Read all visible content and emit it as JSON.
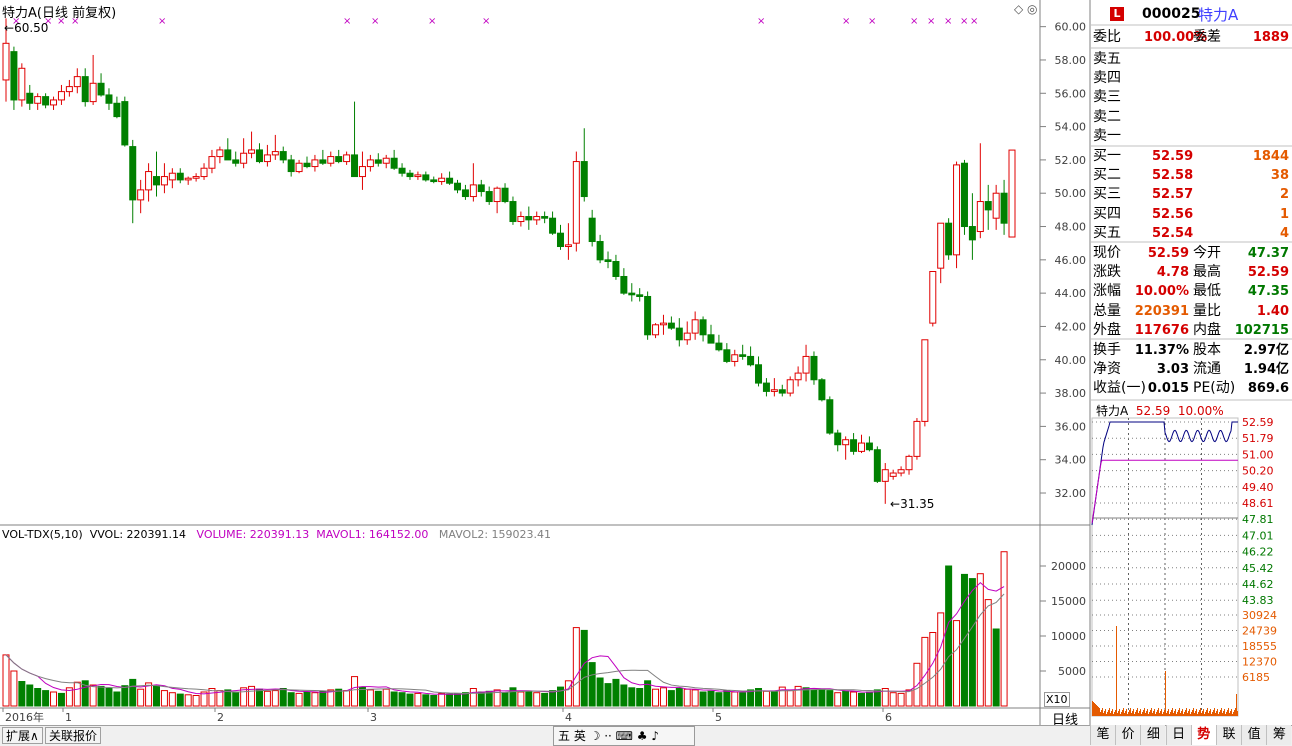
{
  "header": {
    "title": "特力A",
    "title_suffix": "(日线 前复权)",
    "corner_icons": "◇ ◎"
  },
  "main_chart": {
    "high_label": "60.50",
    "low_label": "31.35",
    "y_ticks": [
      "60.00",
      "58.00",
      "56.00",
      "54.00",
      "52.00",
      "50.00",
      "48.00",
      "46.00",
      "44.00",
      "42.00",
      "40.00",
      "38.00",
      "36.00",
      "34.00",
      "32.00"
    ]
  },
  "volume_panel": {
    "title": "VOL-TDX(5,10)",
    "vvol": "VVOL: 220391.14",
    "volume": "VOLUME: 220391.13",
    "mavol1": "MAVOL1: 164152.00",
    "mavol2": "MAVOL2: 159023.41",
    "y_ticks": [
      "20000",
      "15000",
      "10000",
      "5000"
    ],
    "unit": "X10"
  },
  "x_axis": {
    "labels": [
      "2016年",
      "1",
      "2",
      "3",
      "4",
      "5",
      "6"
    ],
    "period": "日线"
  },
  "right_panel": {
    "logo": "L",
    "code": "000025",
    "name": "特力A",
    "weibi_label": "委比",
    "weibi": "100.00%",
    "weicha_label": "委差",
    "weicha": "1889",
    "sells": [
      {
        "label": "卖五",
        "price": "",
        "vol": ""
      },
      {
        "label": "卖四",
        "price": "",
        "vol": ""
      },
      {
        "label": "卖三",
        "price": "",
        "vol": ""
      },
      {
        "label": "卖二",
        "price": "",
        "vol": ""
      },
      {
        "label": "卖一",
        "price": "",
        "vol": ""
      }
    ],
    "buys": [
      {
        "label": "买一",
        "price": "52.59",
        "vol": "1844"
      },
      {
        "label": "买二",
        "price": "52.58",
        "vol": "38"
      },
      {
        "label": "买三",
        "price": "52.57",
        "vol": "2"
      },
      {
        "label": "买四",
        "price": "52.56",
        "vol": "1"
      },
      {
        "label": "买五",
        "price": "52.54",
        "vol": "4"
      }
    ],
    "quote": [
      {
        "l1": "现价",
        "v1": "52.59",
        "c1": "red",
        "l2": "今开",
        "v2": "47.37",
        "c2": "green"
      },
      {
        "l1": "涨跌",
        "v1": "4.78",
        "c1": "red",
        "l2": "最高",
        "v2": "52.59",
        "c2": "red"
      },
      {
        "l1": "涨幅",
        "v1": "10.00%",
        "c1": "red",
        "l2": "最低",
        "v2": "47.35",
        "c2": "green"
      },
      {
        "l1": "总量",
        "v1": "220391",
        "c1": "orange",
        "l2": "量比",
        "v2": "1.40",
        "c2": "red"
      },
      {
        "l1": "外盘",
        "v1": "117676",
        "c1": "red",
        "l2": "内盘",
        "v2": "102715",
        "c2": "green"
      }
    ],
    "stats": [
      {
        "l1": "换手",
        "v1": "11.37%",
        "l2": "股本",
        "v2": "2.97亿"
      },
      {
        "l1": "净资",
        "v1": "3.03",
        "l2": "流通",
        "v2": "1.94亿"
      },
      {
        "l1": "收益(一)",
        "v1": "0.015",
        "l2": "PE(动)",
        "v2": "869.6"
      }
    ],
    "mini": {
      "name": "特力A",
      "price": "52.59",
      "pct": "10.00%",
      "price_ticks": [
        "52.59",
        "51.79",
        "51.00",
        "50.20",
        "49.40",
        "48.61",
        "47.81",
        "47.01",
        "46.22",
        "45.42",
        "44.62",
        "43.83"
      ],
      "vol_ticks": [
        "30924",
        "24739",
        "18555",
        "12370",
        "6185"
      ]
    },
    "tabs": [
      "笔",
      "价",
      "细",
      "日",
      "势",
      "联",
      "值",
      "筹"
    ],
    "active_tab": "势"
  },
  "statusbar": {
    "btn1": "扩展∧",
    "btn2": "关联报价",
    "ime": "五 英 ☽ ·· ⌨ ♣ ♪"
  },
  "colors": {
    "up": "#e00000",
    "down": "#008000",
    "ma1": "#c000c0",
    "ma2": "#808080",
    "wline": "#000080"
  },
  "chart_data": {
    "type": "candlestick",
    "title": "特力A (日线 前复权)",
    "ohlc_approx": [
      [
        56.8,
        60.5,
        55.5,
        59.0
      ],
      [
        58.5,
        58.8,
        55.0,
        55.6
      ],
      [
        55.6,
        57.8,
        55.2,
        57.5
      ],
      [
        56.0,
        56.5,
        55.0,
        55.4
      ],
      [
        55.4,
        56.0,
        55.0,
        55.8
      ],
      [
        55.8,
        56.0,
        55.1,
        55.3
      ],
      [
        55.3,
        55.8,
        55.0,
        55.6
      ],
      [
        55.6,
        56.5,
        55.3,
        56.1
      ],
      [
        56.1,
        56.8,
        55.8,
        56.4
      ],
      [
        56.4,
        57.5,
        56.0,
        57.0
      ],
      [
        57.0,
        57.5,
        55.2,
        55.5
      ],
      [
        55.5,
        58.3,
        55.3,
        56.6
      ],
      [
        56.6,
        57.2,
        55.8,
        55.9
      ],
      [
        55.9,
        56.3,
        55.0,
        55.4
      ],
      [
        55.4,
        55.8,
        54.5,
        54.6
      ],
      [
        55.5,
        55.8,
        52.8,
        52.9
      ],
      [
        52.8,
        53.2,
        48.2,
        49.6
      ],
      [
        49.6,
        50.8,
        48.8,
        50.2
      ],
      [
        50.2,
        51.8,
        49.5,
        51.3
      ],
      [
        51.0,
        52.5,
        49.8,
        50.5
      ],
      [
        50.5,
        51.8,
        50.0,
        51.0
      ],
      [
        50.8,
        51.5,
        50.3,
        51.2
      ],
      [
        51.2,
        51.5,
        50.6,
        50.8
      ],
      [
        50.8,
        51.0,
        50.5,
        50.9
      ],
      [
        50.9,
        51.2,
        50.7,
        51.0
      ],
      [
        51.0,
        51.8,
        50.8,
        51.5
      ],
      [
        51.5,
        52.6,
        51.2,
        52.2
      ],
      [
        52.2,
        52.8,
        51.8,
        52.6
      ],
      [
        52.6,
        53.3,
        52.0,
        52.0
      ],
      [
        52.0,
        52.5,
        51.6,
        51.8
      ],
      [
        51.8,
        53.3,
        51.5,
        52.4
      ],
      [
        52.4,
        53.7,
        52.1,
        52.6
      ],
      [
        52.6,
        53.0,
        51.8,
        51.9
      ],
      [
        51.9,
        52.9,
        51.6,
        52.3
      ],
      [
        52.3,
        53.5,
        52.0,
        52.5
      ],
      [
        52.5,
        52.8,
        51.8,
        52.0
      ],
      [
        52.0,
        52.3,
        51.0,
        51.3
      ],
      [
        51.3,
        52.0,
        51.2,
        51.8
      ],
      [
        51.8,
        52.2,
        51.5,
        51.6
      ],
      [
        51.6,
        52.3,
        51.3,
        52.0
      ],
      [
        52.0,
        52.6,
        51.7,
        51.8
      ],
      [
        51.8,
        52.5,
        51.6,
        52.2
      ],
      [
        52.2,
        52.6,
        51.8,
        51.9
      ],
      [
        51.9,
        52.5,
        51.7,
        52.3
      ],
      [
        52.3,
        55.5,
        52.0,
        51.0
      ],
      [
        51.0,
        52.5,
        50.2,
        51.6
      ],
      [
        51.6,
        52.3,
        51.3,
        52.0
      ],
      [
        52.0,
        52.4,
        51.6,
        51.8
      ],
      [
        51.8,
        52.3,
        51.5,
        52.1
      ],
      [
        52.1,
        52.6,
        51.4,
        51.5
      ],
      [
        51.5,
        51.8,
        51.0,
        51.2
      ],
      [
        51.2,
        51.4,
        50.8,
        51.0
      ],
      [
        51.0,
        51.3,
        50.8,
        51.1
      ],
      [
        51.1,
        51.3,
        50.7,
        50.8
      ],
      [
        50.8,
        51.0,
        50.6,
        50.7
      ],
      [
        50.7,
        51.2,
        50.5,
        50.9
      ],
      [
        50.9,
        51.3,
        50.5,
        50.6
      ],
      [
        50.6,
        50.8,
        50.0,
        50.2
      ],
      [
        50.2,
        50.5,
        49.6,
        49.8
      ],
      [
        49.8,
        51.8,
        49.5,
        50.5
      ],
      [
        50.5,
        50.8,
        49.8,
        50.1
      ],
      [
        50.1,
        50.4,
        49.3,
        49.5
      ],
      [
        49.5,
        50.4,
        48.8,
        50.3
      ],
      [
        50.3,
        50.6,
        49.4,
        49.5
      ],
      [
        49.5,
        49.8,
        48.1,
        48.3
      ],
      [
        48.3,
        48.9,
        48.0,
        48.6
      ],
      [
        48.6,
        49.2,
        47.8,
        48.4
      ],
      [
        48.4,
        48.9,
        48.1,
        48.6
      ],
      [
        48.6,
        48.9,
        48.2,
        48.5
      ],
      [
        48.5,
        48.9,
        47.5,
        47.6
      ],
      [
        47.6,
        48.1,
        46.6,
        46.8
      ],
      [
        46.8,
        48.2,
        46.0,
        46.9
      ],
      [
        47.0,
        52.5,
        46.5,
        51.9
      ],
      [
        51.9,
        53.9,
        49.5,
        49.8
      ],
      [
        48.5,
        49.0,
        46.8,
        47.1
      ],
      [
        47.1,
        47.5,
        45.8,
        46.0
      ],
      [
        46.0,
        46.5,
        45.5,
        45.9
      ],
      [
        45.9,
        46.3,
        44.8,
        45.0
      ],
      [
        45.0,
        45.5,
        43.9,
        44.0
      ],
      [
        44.0,
        44.6,
        43.5,
        43.9
      ],
      [
        43.9,
        44.3,
        43.5,
        43.8
      ],
      [
        43.8,
        44.1,
        41.2,
        41.5
      ],
      [
        41.5,
        42.2,
        41.3,
        42.1
      ],
      [
        42.1,
        42.7,
        41.5,
        42.2
      ],
      [
        42.2,
        42.6,
        41.8,
        41.9
      ],
      [
        41.9,
        42.5,
        40.8,
        41.2
      ],
      [
        41.2,
        42.3,
        40.9,
        41.6
      ],
      [
        41.6,
        42.9,
        41.2,
        42.4
      ],
      [
        42.4,
        42.6,
        41.1,
        41.5
      ],
      [
        41.5,
        42.1,
        41.0,
        41.0
      ],
      [
        41.0,
        41.5,
        40.5,
        40.6
      ],
      [
        40.6,
        41.0,
        39.8,
        39.9
      ],
      [
        39.9,
        40.6,
        39.6,
        40.3
      ],
      [
        40.3,
        40.9,
        40.0,
        40.2
      ],
      [
        40.2,
        40.8,
        39.6,
        39.7
      ],
      [
        39.7,
        40.2,
        38.4,
        38.6
      ],
      [
        38.6,
        38.9,
        37.8,
        38.1
      ],
      [
        38.1,
        38.9,
        37.8,
        38.2
      ],
      [
        38.2,
        38.5,
        37.8,
        38.0
      ],
      [
        38.0,
        39.0,
        37.8,
        38.8
      ],
      [
        38.8,
        39.6,
        38.4,
        39.2
      ],
      [
        39.2,
        40.9,
        38.7,
        40.2
      ],
      [
        40.2,
        40.5,
        38.5,
        38.8
      ],
      [
        38.8,
        38.9,
        37.5,
        37.6
      ],
      [
        37.6,
        37.8,
        35.5,
        35.6
      ],
      [
        35.6,
        35.8,
        34.5,
        34.9
      ],
      [
        34.9,
        35.4,
        34.0,
        35.2
      ],
      [
        35.2,
        35.6,
        34.3,
        34.5
      ],
      [
        34.5,
        35.5,
        34.4,
        35.0
      ],
      [
        35.0,
        35.4,
        34.5,
        34.6
      ],
      [
        34.6,
        34.8,
        32.6,
        32.7
      ],
      [
        32.7,
        33.8,
        31.35,
        33.4
      ],
      [
        33.0,
        33.4,
        32.8,
        33.2
      ],
      [
        33.2,
        33.6,
        33.0,
        33.4
      ],
      [
        33.4,
        34.3,
        33.1,
        34.2
      ],
      [
        34.2,
        36.5,
        34.0,
        36.3
      ],
      [
        36.3,
        41.2,
        36.0,
        41.2
      ],
      [
        42.2,
        44.8,
        42.0,
        45.3
      ],
      [
        45.5,
        47.0,
        44.6,
        48.2
      ],
      [
        48.2,
        48.5,
        46.0,
        46.3
      ],
      [
        46.3,
        51.9,
        45.5,
        51.7
      ],
      [
        51.8,
        52.0,
        47.5,
        48.0
      ],
      [
        48.0,
        50.0,
        46.0,
        47.2
      ],
      [
        47.7,
        53.0,
        47.3,
        49.5
      ],
      [
        49.5,
        50.5,
        47.8,
        49.0
      ],
      [
        48.5,
        50.5,
        47.8,
        50.0
      ],
      [
        50.0,
        50.8,
        47.5,
        48.2
      ],
      [
        47.37,
        52.59,
        47.35,
        52.59
      ]
    ],
    "ylim": [
      30.5,
      61.0
    ],
    "volume": [
      [
        7300,
        "up"
      ],
      [
        5000,
        "up"
      ],
      [
        3500,
        "down"
      ],
      [
        3000,
        "down"
      ],
      [
        2500,
        "down"
      ],
      [
        2200,
        "down"
      ],
      [
        2000,
        "up"
      ],
      [
        1800,
        "down"
      ],
      [
        2600,
        "up"
      ],
      [
        3400,
        "up"
      ],
      [
        3600,
        "down"
      ],
      [
        3000,
        "up"
      ],
      [
        2800,
        "down"
      ],
      [
        2500,
        "down"
      ],
      [
        2000,
        "down"
      ],
      [
        2900,
        "down"
      ],
      [
        3800,
        "down"
      ],
      [
        2400,
        "up"
      ],
      [
        3300,
        "up"
      ],
      [
        2800,
        "down"
      ],
      [
        2200,
        "up"
      ],
      [
        1900,
        "up"
      ],
      [
        1700,
        "down"
      ],
      [
        1600,
        "up"
      ],
      [
        1500,
        "up"
      ],
      [
        2000,
        "up"
      ],
      [
        2500,
        "up"
      ],
      [
        2200,
        "up"
      ],
      [
        2300,
        "down"
      ],
      [
        2000,
        "down"
      ],
      [
        2600,
        "up"
      ],
      [
        2800,
        "up"
      ],
      [
        2400,
        "down"
      ],
      [
        2100,
        "up"
      ],
      [
        2200,
        "up"
      ],
      [
        2500,
        "down"
      ],
      [
        1900,
        "down"
      ],
      [
        1800,
        "up"
      ],
      [
        2000,
        "down"
      ],
      [
        1900,
        "up"
      ],
      [
        2100,
        "down"
      ],
      [
        2300,
        "up"
      ],
      [
        2400,
        "down"
      ],
      [
        2200,
        "up"
      ],
      [
        4200,
        "up"
      ],
      [
        2700,
        "down"
      ],
      [
        2300,
        "up"
      ],
      [
        2100,
        "down"
      ],
      [
        2400,
        "up"
      ],
      [
        2000,
        "down"
      ],
      [
        1900,
        "down"
      ],
      [
        1700,
        "down"
      ],
      [
        1800,
        "up"
      ],
      [
        1600,
        "down"
      ],
      [
        1500,
        "down"
      ],
      [
        1800,
        "up"
      ],
      [
        1700,
        "down"
      ],
      [
        1800,
        "down"
      ],
      [
        1900,
        "down"
      ],
      [
        2500,
        "up"
      ],
      [
        2000,
        "down"
      ],
      [
        2100,
        "down"
      ],
      [
        2300,
        "up"
      ],
      [
        1900,
        "down"
      ],
      [
        2600,
        "down"
      ],
      [
        2000,
        "up"
      ],
      [
        2100,
        "down"
      ],
      [
        1900,
        "up"
      ],
      [
        1800,
        "down"
      ],
      [
        2200,
        "down"
      ],
      [
        2700,
        "down"
      ],
      [
        3600,
        "up"
      ],
      [
        11200,
        "up"
      ],
      [
        10800,
        "down"
      ],
      [
        6200,
        "down"
      ],
      [
        4000,
        "down"
      ],
      [
        3200,
        "down"
      ],
      [
        3800,
        "down"
      ],
      [
        3000,
        "down"
      ],
      [
        2600,
        "down"
      ],
      [
        2500,
        "down"
      ],
      [
        3600,
        "down"
      ],
      [
        2400,
        "up"
      ],
      [
        2600,
        "up"
      ],
      [
        2200,
        "down"
      ],
      [
        2500,
        "down"
      ],
      [
        2400,
        "up"
      ],
      [
        2300,
        "up"
      ],
      [
        2000,
        "down"
      ],
      [
        2100,
        "down"
      ],
      [
        1900,
        "down"
      ],
      [
        2200,
        "down"
      ],
      [
        2000,
        "up"
      ],
      [
        1900,
        "down"
      ],
      [
        2300,
        "down"
      ],
      [
        2500,
        "down"
      ],
      [
        2100,
        "up"
      ],
      [
        2000,
        "down"
      ],
      [
        2700,
        "up"
      ],
      [
        2200,
        "up"
      ],
      [
        2800,
        "up"
      ],
      [
        2600,
        "down"
      ],
      [
        2300,
        "down"
      ],
      [
        2400,
        "down"
      ],
      [
        2200,
        "down"
      ],
      [
        1900,
        "up"
      ],
      [
        2100,
        "down"
      ],
      [
        2000,
        "up"
      ],
      [
        1800,
        "down"
      ],
      [
        2000,
        "down"
      ],
      [
        2300,
        "down"
      ],
      [
        2500,
        "up"
      ],
      [
        1900,
        "up"
      ],
      [
        1800,
        "up"
      ],
      [
        2300,
        "up"
      ],
      [
        6100,
        "up"
      ],
      [
        9800,
        "up"
      ],
      [
        10500,
        "up"
      ],
      [
        13300,
        "up"
      ],
      [
        20000,
        "down"
      ],
      [
        12200,
        "up"
      ],
      [
        18800,
        "down"
      ],
      [
        18200,
        "down"
      ],
      [
        18900,
        "up"
      ],
      [
        15200,
        "up"
      ],
      [
        11000,
        "down"
      ],
      [
        22039,
        "up"
      ]
    ],
    "ma_vol_note": "MAVOL1 / MAVOL2 lines computed from volume"
  }
}
